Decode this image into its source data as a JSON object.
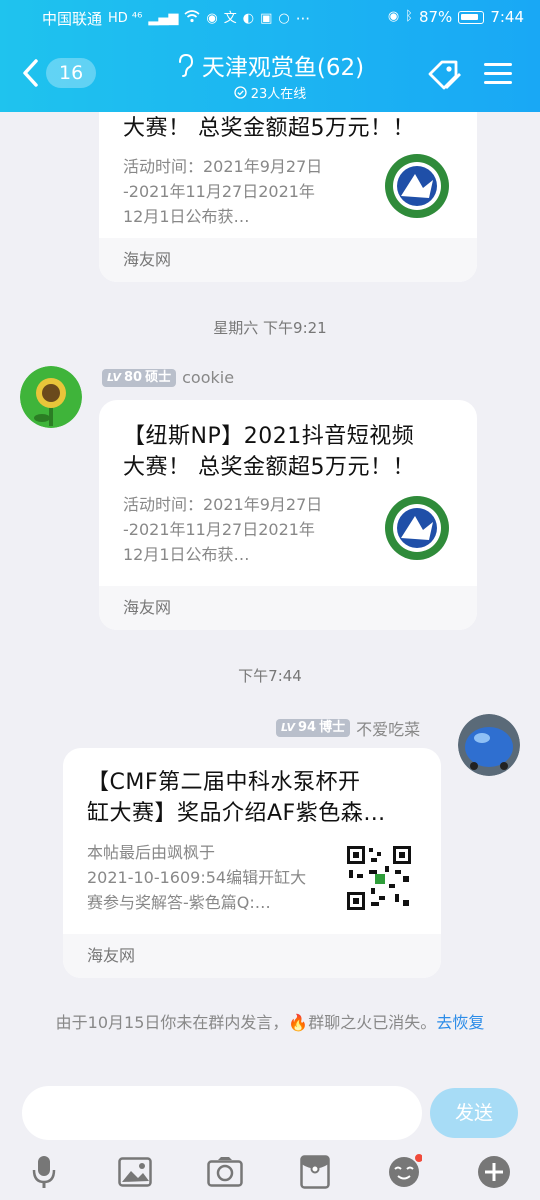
{
  "status_bar": {
    "carrier": "中国联通",
    "network": "HD ⁴⁶",
    "battery": "87%",
    "time": "7:44",
    "dots": "···"
  },
  "header": {
    "back_count": "16",
    "title": "天津观赏鱼(62)",
    "subtitle": "23人在线",
    "accent": "#1fc3ee"
  },
  "cards": [
    {
      "title_lines": [
        "大赛！ 总奖金额超5万元！！"
      ],
      "desc_lines": [
        "活动时间：2021年9月27日",
        "-2021年11月27日2021年",
        "12月1日公布获…"
      ],
      "footer": "海友网"
    },
    {
      "title_lines": [
        "【纽斯NP】2021抖音短视频",
        "大赛！ 总奖金额超5万元！！"
      ],
      "desc_lines": [
        "活动时间：2021年9月27日",
        "-2021年11月27日2021年",
        "12月1日公布获…"
      ],
      "footer": "海友网"
    },
    {
      "title_lines": [
        "【CMF第二届中科水泵杯开",
        "缸大赛】奖品介绍AF紫色森…"
      ],
      "desc_lines": [
        "本帖最后由飒枫于",
        "2021-10-1609:54编辑开缸大",
        "赛参与奖解答-紫色篇Q:…"
      ],
      "footer": "海友网"
    }
  ],
  "time_labels": [
    "星期六 下午9:21",
    "下午7:44"
  ],
  "senders": [
    {
      "level": "80",
      "rank": "硕士",
      "name": "cookie"
    },
    {
      "level": "94",
      "rank": "博士",
      "name": "不爱吃菜"
    }
  ],
  "notice": {
    "text": "由于10月15日你未在群内发言，🔥群聊之火已消失。",
    "link": "去恢复"
  },
  "input": {
    "placeholder": "",
    "send_label": "发送"
  },
  "toolbar": [
    "microphone-icon",
    "image-icon",
    "camera-icon",
    "red-packet-icon",
    "emoji-icon",
    "plus-icon"
  ]
}
